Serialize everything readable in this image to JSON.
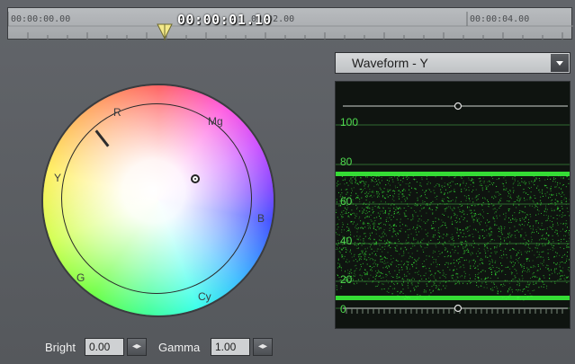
{
  "timeline": {
    "labels": [
      "00:00:00.00",
      "00:00:01.10",
      "00:02.00",
      "00:00:04.00"
    ],
    "current_time": "00:00:01.10"
  },
  "color_wheel": {
    "labels": {
      "r": "R",
      "mg": "Mg",
      "b": "B",
      "cy": "Cy",
      "g": "G",
      "y": "Y"
    }
  },
  "controls": {
    "bright_label": "Bright",
    "bright_value": "0.00",
    "gamma_label": "Gamma",
    "gamma_value": "1.00"
  },
  "scope": {
    "mode": "Waveform - Y",
    "levels": [
      "100",
      "80",
      "60",
      "40",
      "20",
      "0"
    ],
    "trace_color": "#3cff3c"
  }
}
